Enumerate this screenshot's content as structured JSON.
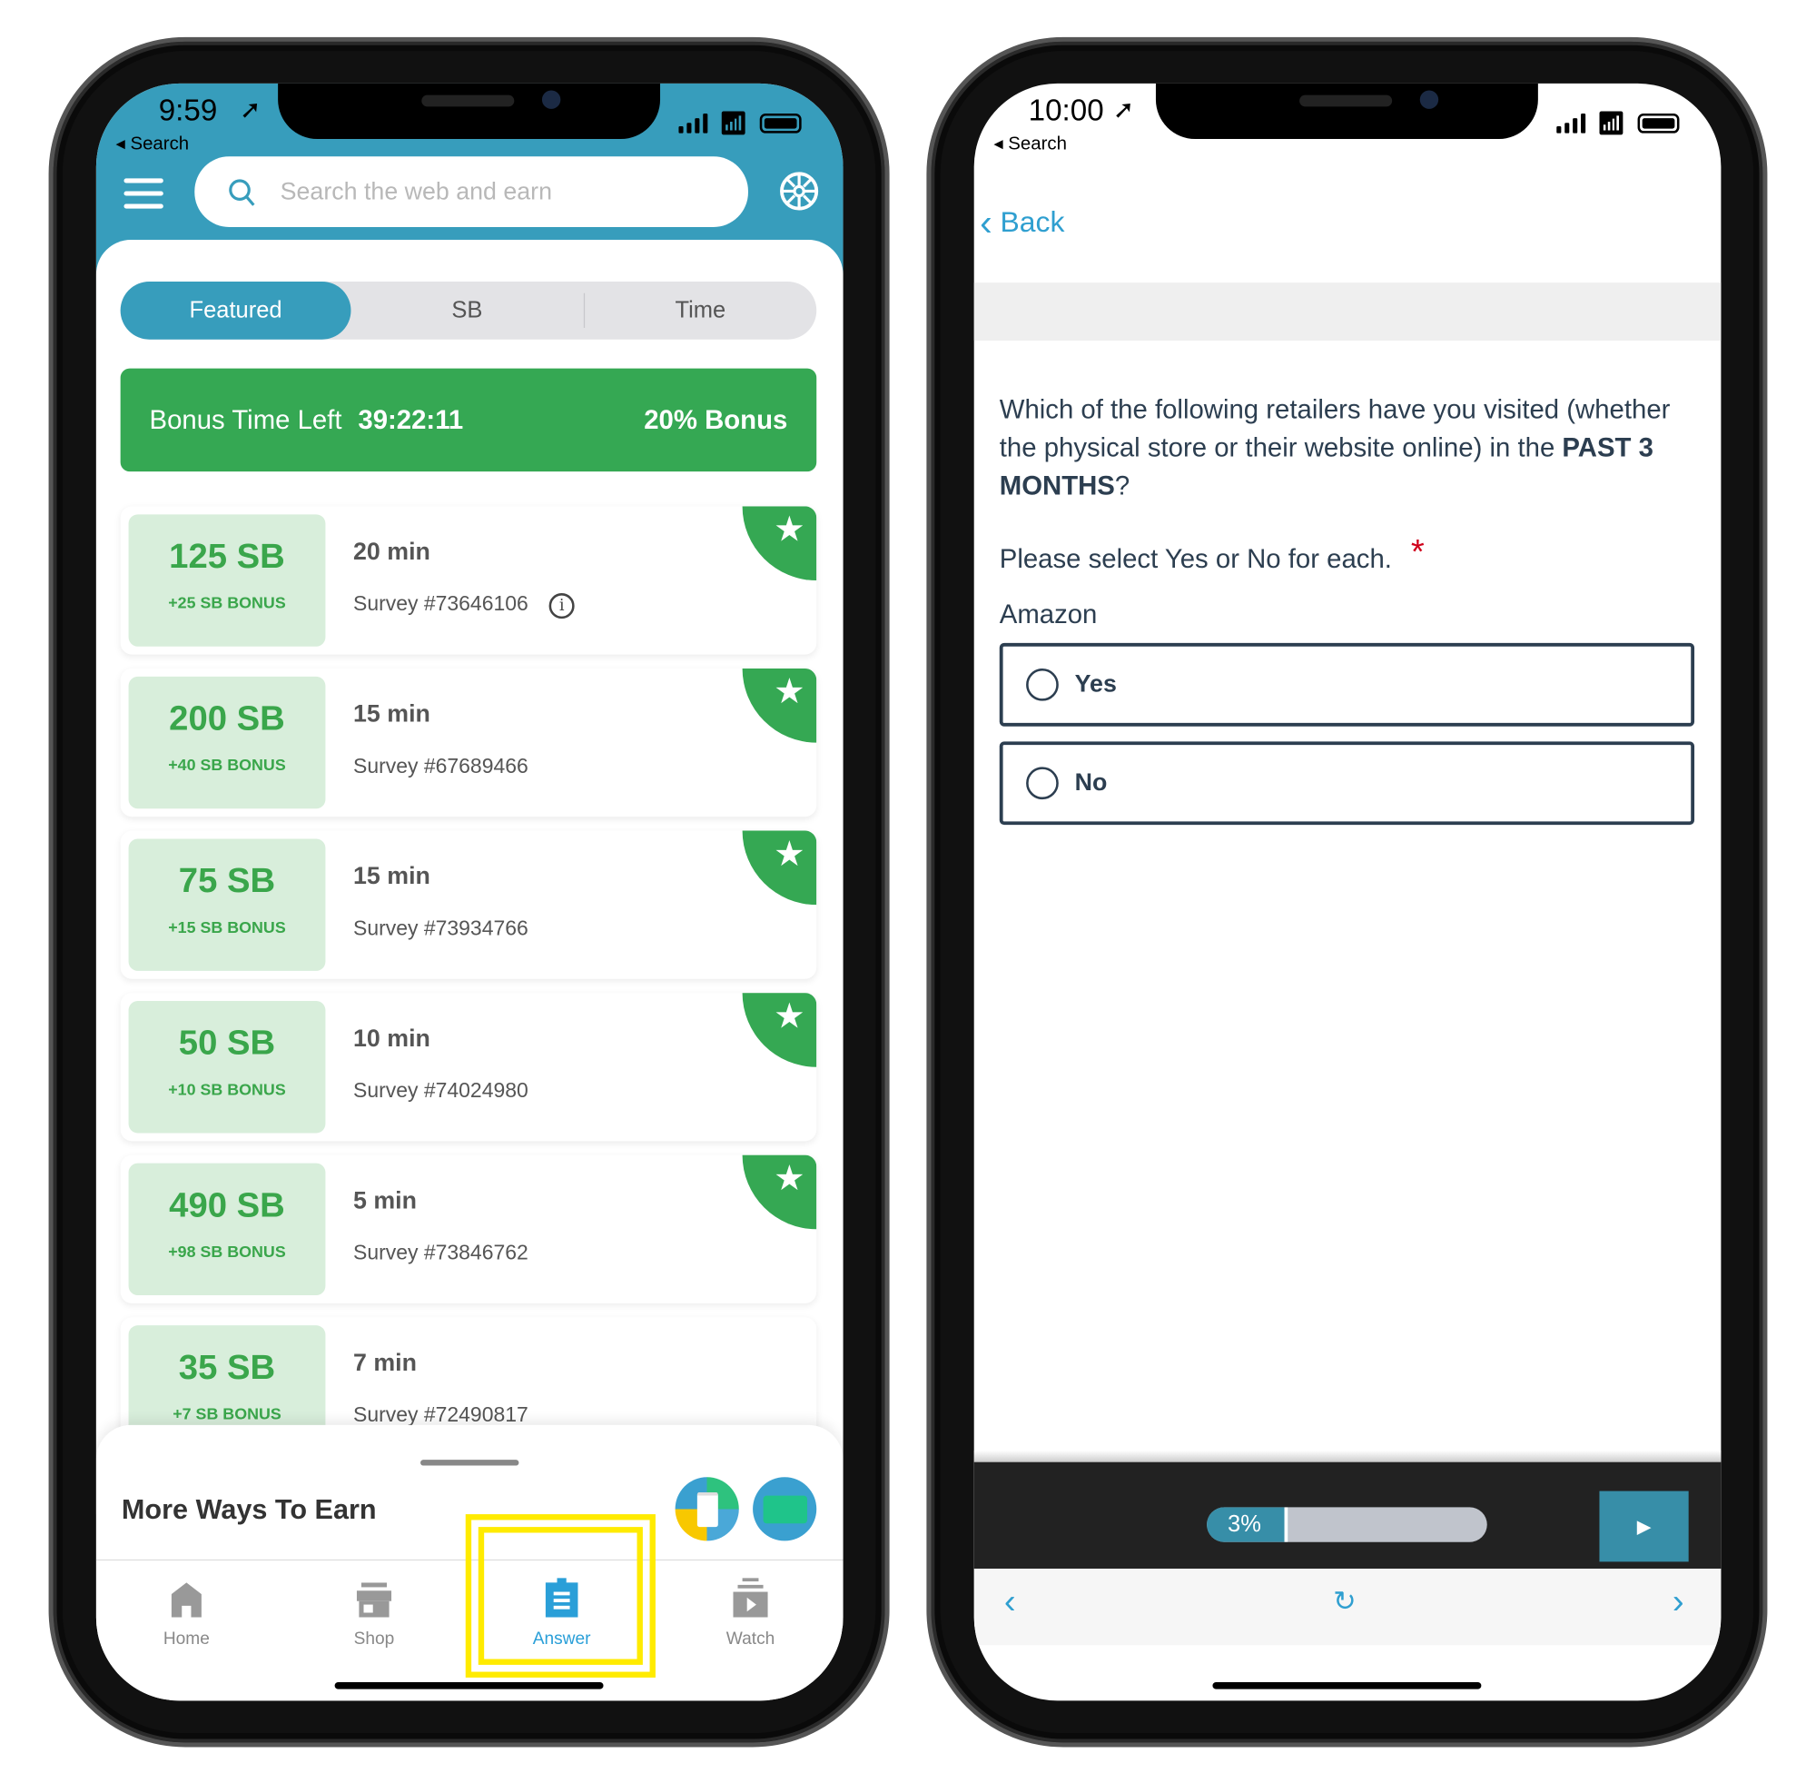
{
  "left_phone": {
    "status": {
      "time": "9:59",
      "back_app": "Search"
    },
    "search": {
      "placeholder": "Search the web and earn"
    },
    "segments": [
      {
        "label": "Featured",
        "active": true
      },
      {
        "label": "SB",
        "active": false
      },
      {
        "label": "Time",
        "active": false
      }
    ],
    "bonus_banner": {
      "label": "Bonus Time Left",
      "countdown": "39:22:11",
      "bonus": "20% Bonus"
    },
    "surveys": [
      {
        "points": "125 SB",
        "bonus": "+25 SB BONUS",
        "duration": "20 min",
        "survey": "Survey #73646106",
        "info": true,
        "featured": true
      },
      {
        "points": "200 SB",
        "bonus": "+40 SB BONUS",
        "duration": "15 min",
        "survey": "Survey #67689466",
        "featured": true
      },
      {
        "points": "75 SB",
        "bonus": "+15 SB BONUS",
        "duration": "15 min",
        "survey": "Survey #73934766",
        "featured": true
      },
      {
        "points": "50 SB",
        "bonus": "+10 SB BONUS",
        "duration": "10 min",
        "survey": "Survey #74024980",
        "featured": true
      },
      {
        "points": "490 SB",
        "bonus": "+98 SB BONUS",
        "duration": "5 min",
        "survey": "Survey #73846762",
        "featured": true
      },
      {
        "points": "35 SB",
        "bonus": "+7 SB BONUS",
        "duration": "7 min",
        "survey": "Survey #72490817",
        "featured": false
      }
    ],
    "more_ways": {
      "title": "More Ways To Earn"
    },
    "tabs": [
      {
        "label": "Home",
        "icon": "home-icon"
      },
      {
        "label": "Shop",
        "icon": "shop-icon"
      },
      {
        "label": "Answer",
        "icon": "clipboard-icon",
        "active": true
      },
      {
        "label": "Watch",
        "icon": "video-icon"
      }
    ],
    "colors": {
      "brand": "#379dbc",
      "green": "#35a853",
      "highlight": "#ffeb00"
    }
  },
  "right_phone": {
    "status": {
      "time": "10:00",
      "back_app": "Search"
    },
    "back_label": "Back",
    "question_pre": "Which of the following retailers have you visited (whether the physical store or their website online) in the ",
    "question_bold": "PAST 3 MONTHS",
    "question_post": "?",
    "instruction": "Please select Yes or No for each.",
    "required_mark": "*",
    "item": "Amazon",
    "options": [
      "Yes",
      "No"
    ],
    "progress": {
      "label": "3%",
      "percent": 3
    }
  }
}
